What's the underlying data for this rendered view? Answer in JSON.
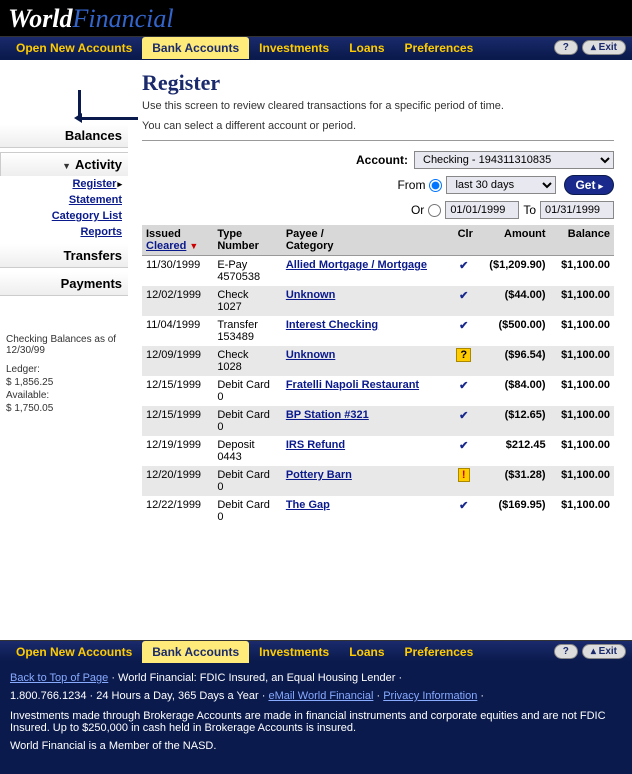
{
  "logo": {
    "part1": "World",
    "part2": "Financial"
  },
  "nav": {
    "items": [
      "Open New Accounts",
      "Bank Accounts",
      "Investments",
      "Loans",
      "Preferences"
    ],
    "help": "?",
    "exit": "Exit"
  },
  "page": {
    "title": "Register",
    "desc1": "Use this screen to review cleared transactions for a specific period of time.",
    "desc2": "You can select a different account or period."
  },
  "sidebar": {
    "tabs": [
      "Balances",
      "Activity",
      "Transfers",
      "Payments"
    ],
    "activity_links": [
      "Register",
      "Statement",
      "Category List",
      "Reports"
    ],
    "info_title": "Checking Balances as of 12/30/99",
    "ledger_label": "Ledger:",
    "ledger_value": "$ 1,856.25",
    "avail_label": "Available:",
    "avail_value": "$ 1,750.05"
  },
  "filter": {
    "account_label": "Account:",
    "account_value": "Checking - 194311310835",
    "from_label": "From",
    "range_value": "last 30 days",
    "or_label": "Or",
    "date_from": "01/01/1999",
    "to_label": "To",
    "date_to": "01/31/1999",
    "get": "Get"
  },
  "table": {
    "headers": {
      "issued": "Issued",
      "cleared": "Cleared",
      "type": "Type",
      "number": "Number",
      "payee": "Payee /",
      "category": "Category",
      "clr": "Clr",
      "amount": "Amount",
      "balance": "Balance"
    },
    "rows": [
      {
        "date": "11/30/1999",
        "type": "E-Pay",
        "number": "4570538",
        "payee": "Allied Mortgage / Mortgage",
        "clr": "check",
        "amount": "($1,209.90)",
        "balance": "$1,100.00"
      },
      {
        "date": "12/02/1999",
        "type": "Check",
        "number": "1027",
        "payee": "Unknown",
        "clr": "check",
        "amount": "($44.00)",
        "balance": "$1,100.00"
      },
      {
        "date": "11/04/1999",
        "type": "Transfer",
        "number": "153489",
        "payee": "Interest Checking",
        "clr": "check",
        "amount": "($500.00)",
        "balance": "$1,100.00"
      },
      {
        "date": "12/09/1999",
        "type": "Check",
        "number": "1028",
        "payee": "Unknown",
        "clr": "warn",
        "amount": "($96.54)",
        "balance": "$1,100.00"
      },
      {
        "date": "12/15/1999",
        "type": "Debit Card",
        "number": "0",
        "payee": "Fratelli Napoli Restaurant",
        "clr": "check",
        "amount": "($84.00)",
        "balance": "$1,100.00"
      },
      {
        "date": "12/15/1999",
        "type": "Debit Card",
        "number": "0",
        "payee": "BP Station #321",
        "clr": "check",
        "amount": "($12.65)",
        "balance": "$1,100.00"
      },
      {
        "date": "12/19/1999",
        "type": "Deposit",
        "number": "0443",
        "payee": "IRS Refund",
        "clr": "check",
        "amount": "$212.45",
        "balance": "$1,100.00"
      },
      {
        "date": "12/20/1999",
        "type": "Debit Card",
        "number": "0",
        "payee": "Pottery Barn",
        "clr": "alert",
        "amount": "($31.28)",
        "balance": "$1,100.00"
      },
      {
        "date": "12/22/1999",
        "type": "Debit Card",
        "number": "0",
        "payee": "The Gap",
        "clr": "check",
        "amount": "($169.95)",
        "balance": "$1,100.00"
      }
    ]
  },
  "footer": {
    "back": "Back to Top of Page",
    "line1a": " · World Financial: FDIC Insured, an Equal Housing Lender ·",
    "line2a": "1.800.766.1234 · 24 Hours a Day, 365 Days a Year · ",
    "email": "eMail World Financial",
    "dot": " · ",
    "privacy": "Privacy Information",
    "line3": "Investments made through Brokerage Accounts are made in financial instruments and corporate equities and are not FDIC Insured. Up to $250,000 in cash held in Brokerage Accounts is insured.",
    "line4": "World Financial is a Member of the NASD."
  }
}
